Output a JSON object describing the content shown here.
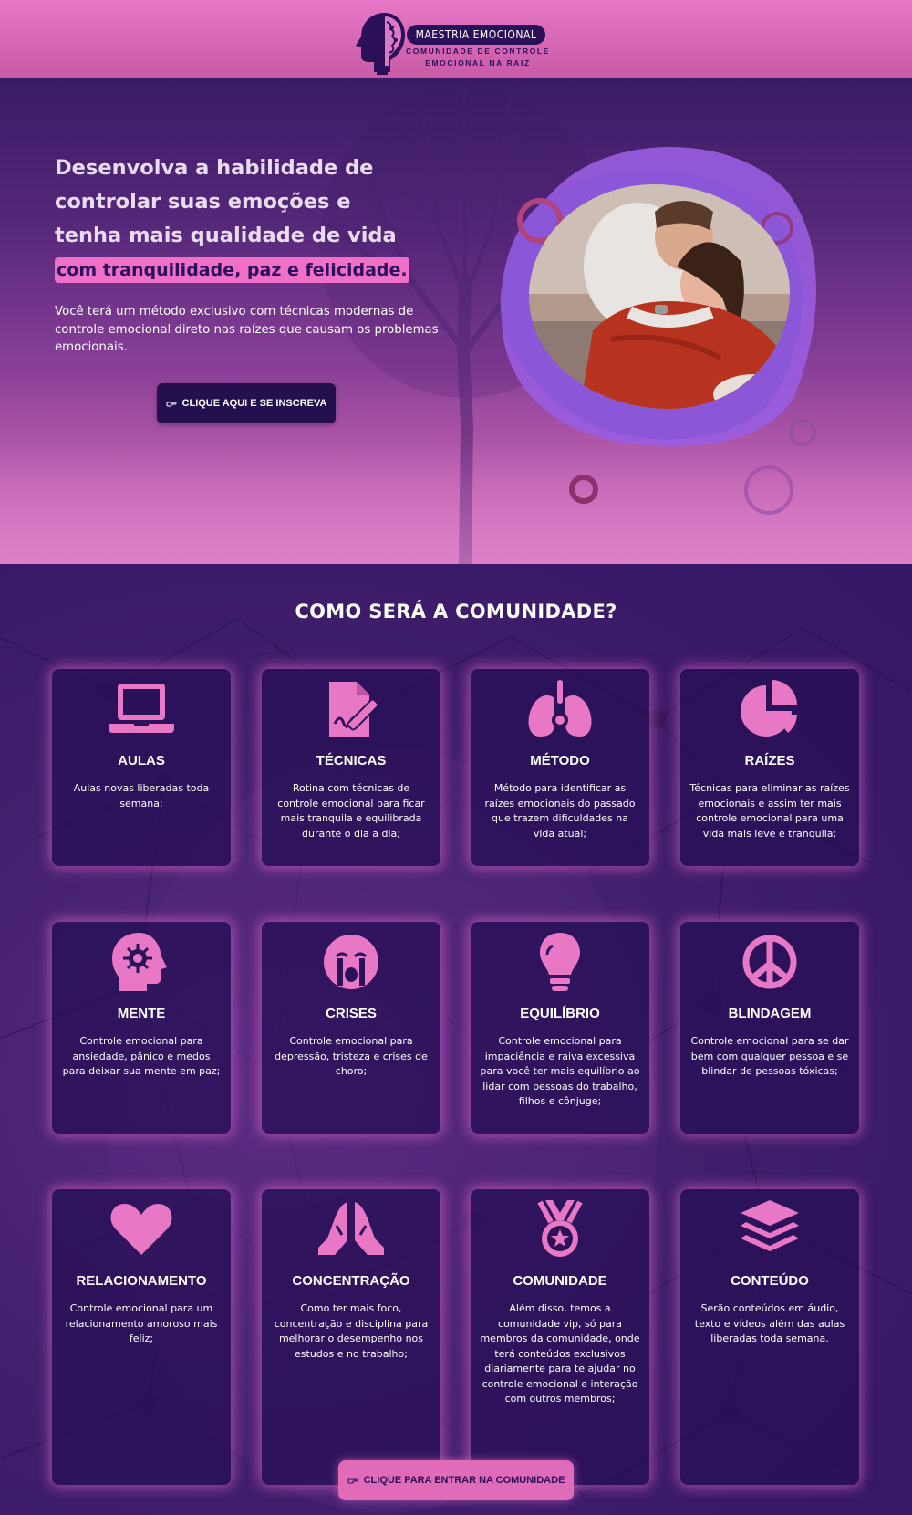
{
  "colors": {
    "accent": "#e877c6",
    "dark": "#2b0f58",
    "pink_highlight": "#f06fc8"
  },
  "header": {
    "logo_title": "MAESTRIA EMOCIONAL",
    "logo_sub_line1": "COMUNIDADE DE CONTROLE",
    "logo_sub_line2": "EMOCIONAL NA RAIZ"
  },
  "hero": {
    "title": "Desenvolva a habilidade de controlar suas emoções e tenha mais qualidade de vida",
    "highlight": "com tranquilidade, paz e felicidade.",
    "text": "Você terá um método exclusivo com técnicas modernas de controle emocional direto nas raízes que causam os problemas emocionais.",
    "cta": "CLIQUE AQUI E SE INSCREVA"
  },
  "community": {
    "title": "COMO SERÁ A COMUNIDADE?",
    "cards": [
      {
        "icon": "laptop-icon",
        "title": "AULAS",
        "text": "Aulas novas liberadas toda semana;"
      },
      {
        "icon": "signature-icon",
        "title": "TÉCNICAS",
        "text": "Rotina com técnicas de controle emocional para ficar mais tranquila e equilibrada durante o dia a dia;"
      },
      {
        "icon": "lungs-virus-icon",
        "title": "MÉTODO",
        "text": "Método para identificar as raízes emocionais do passado que trazem dificuldades na vida atual;"
      },
      {
        "icon": "pie-chart-icon",
        "title": "RAÍZES",
        "text": "Técnicas para eliminar as raízes emocionais e assim ter mais controle emocional para uma vida mais leve e tranquila;"
      },
      {
        "icon": "head-virus-icon",
        "title": "MENTE",
        "text": "Controle emocional para ansiedade, pânico e medos para deixar sua mente em paz;"
      },
      {
        "icon": "sad-cry-icon",
        "title": "CRISES",
        "text": "Controle emocional para depressão, tristeza e crises de choro;"
      },
      {
        "icon": "lightbulb-icon",
        "title": "EQUILÍBRIO",
        "text": "Controle emocional para impaciência e raiva excessiva para você ter mais equilíbrio ao lidar com pessoas do trabalho, filhos e cônjuge;"
      },
      {
        "icon": "peace-icon",
        "title": "BLINDAGEM",
        "text": "Controle emocional para se dar bem com qualquer pessoa e se blindar de pessoas tóxicas;"
      },
      {
        "icon": "heart-icon",
        "title": "RELACIONAMENTO",
        "text": "Controle emocional para um relacionamento amoroso mais feliz;"
      },
      {
        "icon": "praying-hands-icon",
        "title": "CONCENTRAÇÃO",
        "text": "Como ter mais foco, concentração e disciplina para melhorar o desempenho nos estudos e no trabalho;"
      },
      {
        "icon": "medal-icon",
        "title": "COMUNIDADE",
        "text": "Além disso, temos a comunidade vip, só para membros da comunidade, onde terá conteúdos exclusivos diariamente para te ajudar no controle emocional e interação com outros membros;"
      },
      {
        "icon": "layer-group-icon",
        "title": "CONTEÚDO",
        "text": "Serão conteúdos em áudio, texto e vídeos além das aulas liberadas toda semana."
      }
    ],
    "cta": "CLIQUE PARA ENTRAR NA COMUNIDADE"
  }
}
